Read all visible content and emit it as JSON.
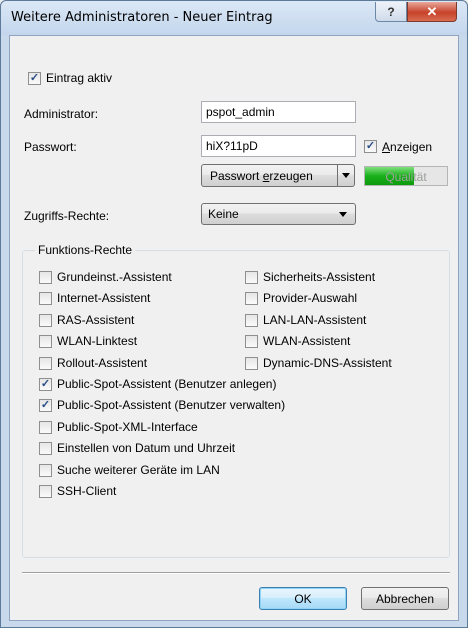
{
  "window": {
    "title": "Weitere Administratoren - Neuer Eintrag",
    "help_glyph": "?",
    "close_glyph": "✕"
  },
  "form": {
    "entry_active": {
      "label": "Eintrag aktiv",
      "checked": true
    },
    "administrator": {
      "label": "Administrator:",
      "value": "pspot_admin"
    },
    "password": {
      "label": "Passwort:",
      "value": "hiX?11pD",
      "show_label_pre": "",
      "show_label_accel": "A",
      "show_label_post": "nzeigen",
      "show_checked": true
    },
    "generate_button": {
      "pre": "Passwort ",
      "accel": "e",
      "post": "rzeugen"
    },
    "quality": {
      "label": "Qualität",
      "fraction": 0.6
    },
    "access_rights": {
      "label": "Zugriffs-Rechte:",
      "selected": "Keine"
    }
  },
  "functions": {
    "title": "Funktions-Rechte",
    "left": [
      {
        "label": "Grundeinst.-Assistent",
        "checked": false
      },
      {
        "label": "Internet-Assistent",
        "checked": false
      },
      {
        "label": "RAS-Assistent",
        "checked": false
      },
      {
        "label": "WLAN-Linktest",
        "checked": false
      },
      {
        "label": "Rollout-Assistent",
        "checked": false
      }
    ],
    "right": [
      {
        "label": "Sicherheits-Assistent",
        "checked": false
      },
      {
        "label": "Provider-Auswahl",
        "checked": false
      },
      {
        "label": "LAN-LAN-Assistent",
        "checked": false
      },
      {
        "label": "WLAN-Assistent",
        "checked": false
      },
      {
        "label": "Dynamic-DNS-Assistent",
        "checked": false
      }
    ],
    "full": [
      {
        "label": "Public-Spot-Assistent (Benutzer anlegen)",
        "checked": true
      },
      {
        "label": "Public-Spot-Assistent (Benutzer verwalten)",
        "checked": true
      },
      {
        "label": "Public-Spot-XML-Interface",
        "checked": false
      },
      {
        "label": "Einstellen von Datum und Uhrzeit",
        "checked": false
      },
      {
        "label": "Suche weiterer Geräte im LAN",
        "checked": false
      },
      {
        "label": "SSH-Client",
        "checked": false
      }
    ]
  },
  "buttons": {
    "ok": "OK",
    "cancel": "Abbrechen"
  },
  "check_glyph": "✓"
}
